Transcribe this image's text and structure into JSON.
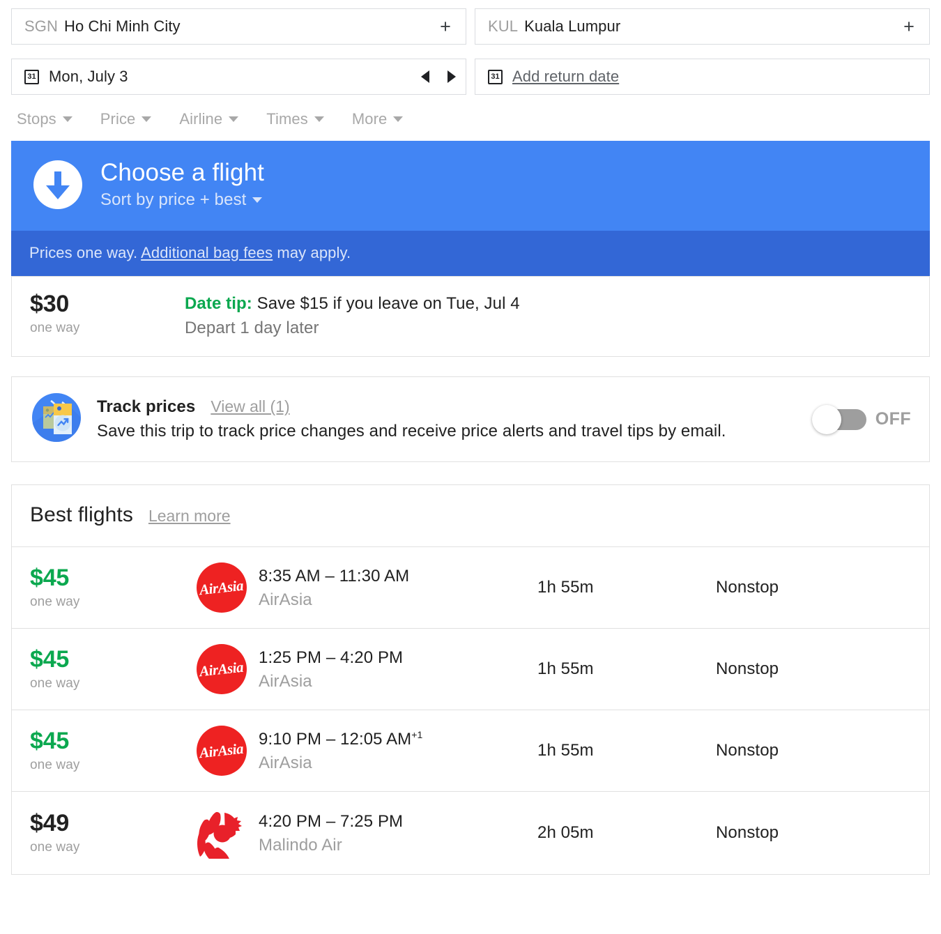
{
  "search": {
    "origin": {
      "code": "SGN",
      "city": "Ho Chi Minh City",
      "add_label": "+"
    },
    "destination": {
      "code": "KUL",
      "city": "Kuala Lumpur",
      "add_label": "+"
    },
    "depart_date": "Mon, July 3",
    "return_placeholder": "Add return date",
    "calendar_glyph": "31"
  },
  "filters": [
    {
      "label": "Stops"
    },
    {
      "label": "Price"
    },
    {
      "label": "Airline"
    },
    {
      "label": "Times"
    },
    {
      "label": "More"
    }
  ],
  "banner": {
    "title": "Choose a flight",
    "sort_label": "Sort by price + best",
    "notice_prefix": "Prices one way. ",
    "notice_link": "Additional bag fees",
    "notice_suffix": " may apply.",
    "bg_color": "#4285f4",
    "notice_bg_color": "#3367d6"
  },
  "date_tip": {
    "price": "$30",
    "price_sub": "one way",
    "tip_label": "Date tip:",
    "tip_text": " Save $15 if you leave on Tue, Jul 4",
    "tip_detail": "Depart 1 day later",
    "accent_color": "#0ba84f"
  },
  "track_prices": {
    "title": "Track prices",
    "view_all": "View all (1)",
    "description": "Save this trip to track price changes and receive price alerts and travel tips by email.",
    "toggle_state": "OFF"
  },
  "results": {
    "title": "Best flights",
    "learn_more": "Learn more",
    "flights": [
      {
        "price": "$45",
        "price_sub": "one way",
        "price_green": true,
        "logo": "airasia-logo",
        "logo_text": "AirAsia",
        "times": "8:35 AM – 11:30 AM",
        "overnight": "",
        "airline": "AirAsia",
        "duration": "1h 55m",
        "stops": "Nonstop"
      },
      {
        "price": "$45",
        "price_sub": "one way",
        "price_green": true,
        "logo": "airasia-logo",
        "logo_text": "AirAsia",
        "times": "1:25 PM – 4:20 PM",
        "overnight": "",
        "airline": "AirAsia",
        "duration": "1h 55m",
        "stops": "Nonstop"
      },
      {
        "price": "$45",
        "price_sub": "one way",
        "price_green": true,
        "logo": "airasia-logo",
        "logo_text": "AirAsia",
        "times": "9:10 PM – 12:05 AM",
        "overnight": "+1",
        "airline": "AirAsia",
        "duration": "1h 55m",
        "stops": "Nonstop"
      },
      {
        "price": "$49",
        "price_sub": "one way",
        "price_green": false,
        "logo": "malindo-lion-logo",
        "logo_text": "",
        "times": "4:20 PM – 7:25 PM",
        "overnight": "",
        "airline": "Malindo Air",
        "duration": "2h 05m",
        "stops": "Nonstop"
      }
    ]
  }
}
